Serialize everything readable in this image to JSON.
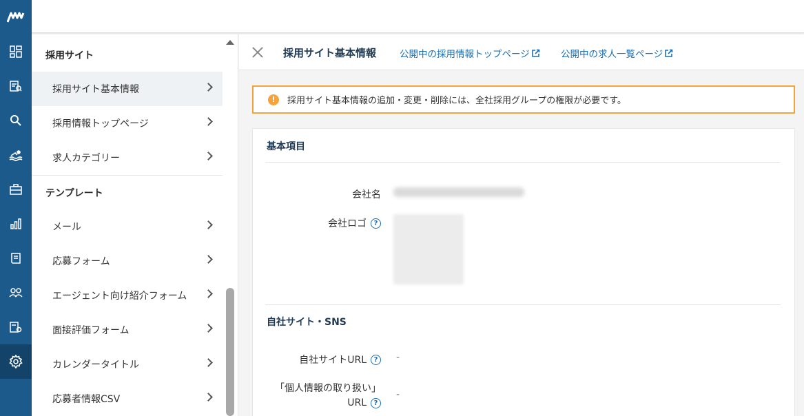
{
  "rail": {
    "logo": "logo-icon",
    "items": [
      {
        "icon": "dashboard-icon"
      },
      {
        "icon": "document-search-icon"
      },
      {
        "icon": "magnifier-icon"
      },
      {
        "icon": "swimmer-icon"
      },
      {
        "icon": "briefcase-icon"
      },
      {
        "icon": "bar-chart-icon"
      },
      {
        "icon": "book-icon"
      },
      {
        "icon": "people-icon"
      },
      {
        "icon": "document-settings-icon"
      },
      {
        "icon": "gear-icon"
      }
    ],
    "active_color": "#134369",
    "bg_color": "#1d5a8c"
  },
  "submenu": {
    "sections": [
      {
        "title": "採用サイト",
        "items": [
          {
            "label": "採用サイト基本情報",
            "active": true
          },
          {
            "label": "採用情報トップページ"
          },
          {
            "label": "求人カテゴリー"
          }
        ]
      },
      {
        "title": "テンプレート",
        "items": [
          {
            "label": "メール"
          },
          {
            "label": "応募フォーム"
          },
          {
            "label": "エージェント向け紹介フォーム"
          },
          {
            "label": "面接評価フォーム"
          },
          {
            "label": "カレンダータイトル"
          },
          {
            "label": "応募者情報CSV"
          }
        ]
      }
    ]
  },
  "main": {
    "title": "採用サイト基本情報",
    "links": [
      {
        "label": "公開中の採用情報トップページ"
      },
      {
        "label": "公開中の求人一覧ページ"
      }
    ],
    "alert": {
      "icon": "!",
      "text": "採用サイト基本情報の追加・変更・削除には、全社採用グループの権限が必要です。",
      "border_color": "#f5a33a"
    },
    "basic": {
      "title": "基本項目",
      "company_name_label": "会社名",
      "company_logo_label": "会社ロゴ"
    },
    "sns": {
      "title": "自社サイト・SNS",
      "site_url_label": "自社サイトURL",
      "site_url_value": "-",
      "privacy_label_1": "「個人情報の取り扱い」",
      "privacy_label_2": "URL",
      "privacy_value": "-"
    }
  }
}
